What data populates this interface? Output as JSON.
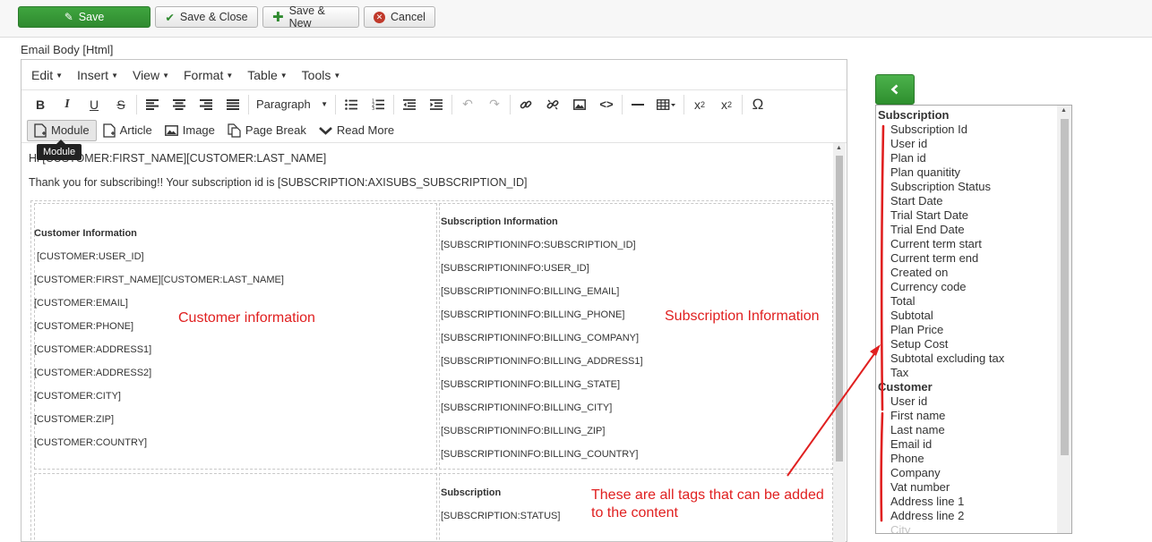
{
  "toolbar": {
    "save": "Save",
    "save_close": "Save & Close",
    "save_new": "Save & New",
    "cancel": "Cancel"
  },
  "field_label": "Email Body [Html]",
  "editor": {
    "menus": [
      "Edit",
      "Insert",
      "View",
      "Format",
      "Table",
      "Tools"
    ],
    "paragraph": "Paragraph",
    "plugins": {
      "module": "Module",
      "article": "Article",
      "image": "Image",
      "page_break": "Page Break",
      "read_more": "Read More"
    },
    "tooltip": "Module",
    "line1": "Hi [CUSTOMER:FIRST_NAME][CUSTOMER:LAST_NAME]",
    "line2": "Thank you for subscribing!! Your subscription id is [SUBSCRIPTION:AXISUBS_SUBSCRIPTION_ID]",
    "customer_heading": "Customer Information",
    "customer_fields": [
      "[CUSTOMER:USER_ID]",
      "[CUSTOMER:FIRST_NAME][CUSTOMER:LAST_NAME]",
      "[CUSTOMER:EMAIL]",
      "[CUSTOMER:PHONE]",
      "[CUSTOMER:ADDRESS1]",
      "[CUSTOMER:ADDRESS2]",
      "[CUSTOMER:CITY]",
      "[CUSTOMER:ZIP]",
      "[CUSTOMER:COUNTRY]"
    ],
    "subscription_heading": "Subscription Information",
    "subscription_fields": [
      "[SUBSCRIPTIONINFO:SUBSCRIPTION_ID]",
      "[SUBSCRIPTIONINFO:USER_ID]",
      "[SUBSCRIPTIONINFO:BILLING_EMAIL]",
      "[SUBSCRIPTIONINFO:BILLING_PHONE]",
      "[SUBSCRIPTIONINFO:BILLING_COMPANY]",
      "[SUBSCRIPTIONINFO:BILLING_ADDRESS1]",
      "[SUBSCRIPTIONINFO:BILLING_STATE]",
      "[SUBSCRIPTIONINFO:BILLING_CITY]",
      "[SUBSCRIPTIONINFO:BILLING_ZIP]",
      "[SUBSCRIPTIONINFO:BILLING_COUNTRY]"
    ],
    "sub2_heading": "Subscription",
    "sub2_fields": [
      "[SUBSCRIPTION:STATUS]"
    ]
  },
  "annotations": {
    "customer": "Customer information",
    "subscription": "Subscription Information",
    "tags_line1": "These are all tags that can be added",
    "tags_line2": "to the content"
  },
  "tags": {
    "subscription_group": "Subscription",
    "subscription_items": [
      "Subscription Id",
      "User id",
      "Plan id",
      "Plan quanitity",
      "Subscription Status",
      "Start Date",
      "Trial Start Date",
      "Trial End Date",
      "Current term start",
      "Current term end",
      "Created on",
      "Currency code",
      "Total",
      "Subtotal",
      "Plan Price",
      "Setup Cost",
      "Subtotal excluding tax",
      "Tax"
    ],
    "customer_group": "Customer",
    "customer_items": [
      "User id",
      "First name",
      "Last name",
      "Email id",
      "Phone",
      "Company",
      "Vat number",
      "Address line 1",
      "Address line 2",
      "City"
    ]
  },
  "colors": {
    "accent_green": "#2f8a2f",
    "annotation_red": "#e02020"
  }
}
